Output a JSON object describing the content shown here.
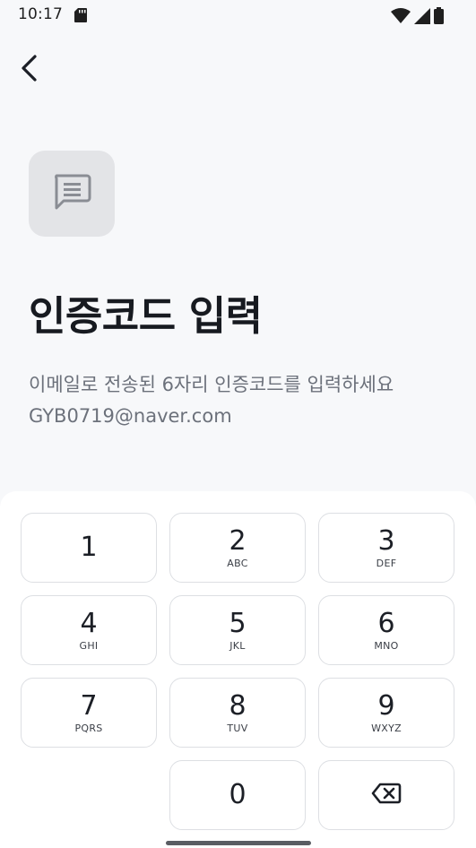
{
  "status_bar": {
    "time": "10:17",
    "icons": [
      "sd-card-icon",
      "wifi-icon",
      "signal-icon",
      "battery-icon"
    ]
  },
  "nav": {
    "back_icon": "chevron-left-icon"
  },
  "header": {
    "icon": "message-icon",
    "title": "인증코드 입력",
    "description": "이메일로 전송된 6자리 인증코드를 입력하세요",
    "email": "GYB0719@naver.com"
  },
  "keypad": {
    "keys": [
      {
        "digit": "1",
        "letters": ""
      },
      {
        "digit": "2",
        "letters": "ABC"
      },
      {
        "digit": "3",
        "letters": "DEF"
      },
      {
        "digit": "4",
        "letters": "GHI"
      },
      {
        "digit": "5",
        "letters": "JKL"
      },
      {
        "digit": "6",
        "letters": "MNO"
      },
      {
        "digit": "7",
        "letters": "PQRS"
      },
      {
        "digit": "8",
        "letters": "TUV"
      },
      {
        "digit": "9",
        "letters": "WXYZ"
      },
      {
        "digit": "0",
        "letters": ""
      }
    ],
    "backspace_icon": "backspace-icon"
  },
  "colors": {
    "background": "#f7f8fa",
    "keypad_background": "#ffffff",
    "icon_tile": "#e3e4e7",
    "title": "#171a20",
    "description": "#6c717b",
    "key_border": "#dddfe3"
  }
}
